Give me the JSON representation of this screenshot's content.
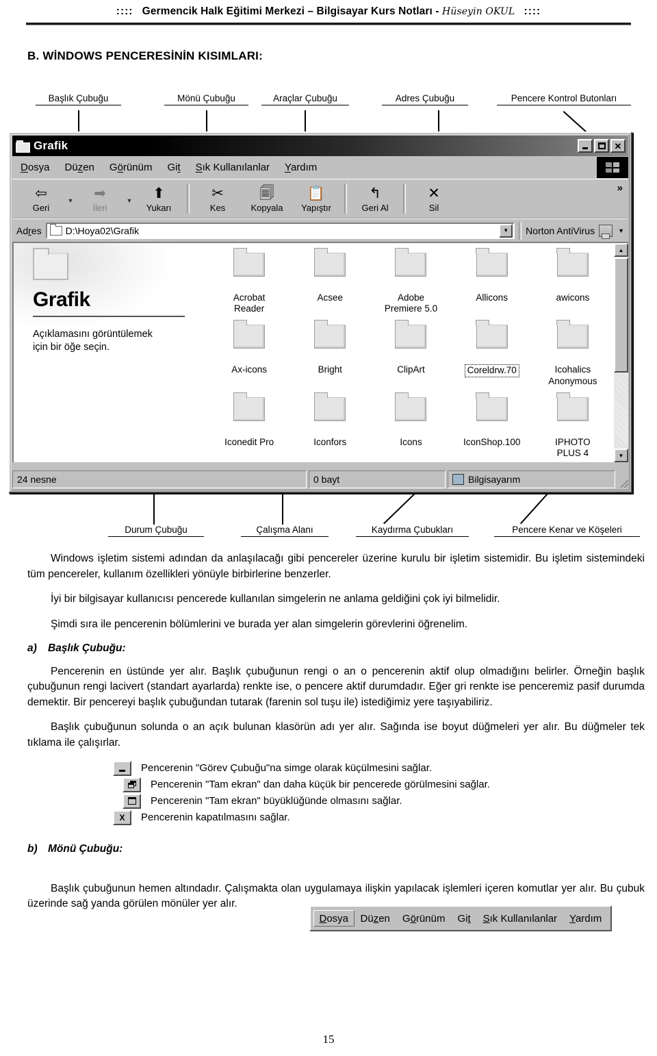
{
  "header": {
    "dots_left": "::::",
    "title": "Germencik Halk Eğitimi Merkezi – Bilgisayar Kurs Notları - ",
    "author": "Hüseyin OKUL",
    "dots_right": "::::"
  },
  "section_title": "B. WİNDOWS PENCERESİNİN KISIMLARI:",
  "diagram": {
    "callouts_top": [
      "Başlık Çubuğu",
      "Mönü Çubuğu",
      "Araçlar Çubuğu",
      "Adres Çubuğu",
      "Pencere Kontrol Butonları"
    ],
    "callouts_bottom": [
      "Durum Çubuğu",
      "Çalışma Alanı",
      "Kaydırma Çubukları",
      "Pencere Kenar ve Köşeleri"
    ],
    "window": {
      "title": "Grafik",
      "control_buttons": [
        "minimize",
        "maximize",
        "close"
      ],
      "menu_items": [
        {
          "pre": "",
          "hot": "D",
          "post": "osya"
        },
        {
          "pre": "Dü",
          "hot": "z",
          "post": "en"
        },
        {
          "pre": "G",
          "hot": "ö",
          "post": "rünüm"
        },
        {
          "pre": "Gi",
          "hot": "t",
          "post": ""
        },
        {
          "pre": "",
          "hot": "S",
          "post": "ık Kullanılanlar"
        },
        {
          "pre": "",
          "hot": "Y",
          "post": "ardım"
        }
      ],
      "toolbar": [
        {
          "label": "Geri",
          "icon": "back-arrow-icon",
          "glyph": "⇦",
          "disabled": false,
          "dropdown": true
        },
        {
          "label": "İleri",
          "icon": "forward-arrow-icon",
          "glyph": "➡",
          "disabled": true,
          "dropdown": true
        },
        {
          "label": "Yukarı",
          "icon": "up-folder-icon",
          "glyph": "⬆",
          "disabled": false,
          "dropdown": false
        },
        {
          "label": "Kes",
          "icon": "scissors-icon",
          "glyph": "✂",
          "disabled": false,
          "dropdown": false
        },
        {
          "label": "Kopyala",
          "icon": "copy-icon",
          "glyph": "🗐",
          "disabled": false,
          "dropdown": false
        },
        {
          "label": "Yapıştır",
          "icon": "paste-icon",
          "glyph": "📋",
          "disabled": false,
          "dropdown": false
        },
        {
          "label": "Geri Al",
          "icon": "undo-arrow-icon",
          "glyph": "↰",
          "disabled": false,
          "dropdown": false
        },
        {
          "label": "Sil",
          "icon": "delete-x-icon",
          "glyph": "✕",
          "disabled": false,
          "dropdown": false
        }
      ],
      "toolbar_overflow": "»",
      "address": {
        "label": "Adres",
        "value": "D:\\Hoya02\\Grafik",
        "antivirus_label": "Norton AntiVirus"
      },
      "left_pane": {
        "title": "Grafik",
        "description": "Açıklamasını görüntülemek için bir öğe seçin."
      },
      "folders": [
        {
          "name": "Acrobat\nReader",
          "focused": false
        },
        {
          "name": "Acsee",
          "focused": false
        },
        {
          "name": "Adobe\nPremiere 5.0",
          "focused": false
        },
        {
          "name": "Allicons",
          "focused": false
        },
        {
          "name": "awicons",
          "focused": false
        },
        {
          "name": "Ax-icons",
          "focused": false
        },
        {
          "name": "Bright",
          "focused": false
        },
        {
          "name": "ClipArt",
          "focused": false
        },
        {
          "name": "Coreldrw.70",
          "focused": true
        },
        {
          "name": "Icohalics\nAnonymous",
          "focused": false
        },
        {
          "name": "Iconedit Pro",
          "focused": false
        },
        {
          "name": "Iconfors",
          "focused": false
        },
        {
          "name": "Icons",
          "focused": false
        },
        {
          "name": "IconShop.100",
          "focused": false
        },
        {
          "name": "IPHOTO\nPLUS 4",
          "focused": false
        }
      ],
      "status_bar": {
        "objects": "24 nesne",
        "size": "0 bayt",
        "location": "Bilgisayarım"
      }
    }
  },
  "paragraphs": {
    "p1": "Windows işletim sistemi adından da anlaşılacağı gibi pencereler üzerine kurulu bir işletim sistemidir. Bu işletim sistemindeki tüm pencereler, kullanım özellikleri yönüyle birbirlerine benzerler.",
    "p2": "İyi bir bilgisayar kullanıcısı pencerede kullanılan simgelerin ne anlama geldiğini çok iyi bilmelidir.",
    "p3": "Şimdi sıra ile pencerenin bölümlerini ve burada yer alan simgelerin görevlerini öğrenelim.",
    "p4": "Pencerenin en üstünde yer alır. Başlık çubuğunun rengi o an o pencerenin aktif olup olmadığını belirler. Örneğin başlık çubuğunun rengi lacivert (standart ayarlarda) renkte ise, o pencere aktif durumdadır. Eğer gri renkte ise penceremiz pasif durumda demektir. Bir pencereyi başlık çubuğundan tutarak (farenin sol tuşu ile) istediğimiz yere taşıyabiliriz.",
    "p5": "Başlık çubuğunun solunda o an açık bulunan klasörün adı yer alır. Sağında ise  boyut düğmeleri yer alır. Bu düğmeler tek tıklama ile çalışırlar.",
    "p6": "Başlık çubuğunun hemen altındadır. Çalışmakta olan uygulamaya ilişkin yapılacak işlemleri içeren komutlar yer alır. Bu çubuk üzerinde sağ yanda görülen mönüler yer alır."
  },
  "subheads": {
    "a_marker": "a)",
    "a_label": "Başlık Çubuğu:",
    "b_marker": "b)",
    "b_label": "Mönü Çubuğu:"
  },
  "button_descriptions": [
    {
      "icon": "minimize-button-icon",
      "text": "Pencerenin \"Görev Çubuğu\"na simge olarak küçülmesini sağlar."
    },
    {
      "icon": "restore-button-icon",
      "text": "Pencerenin \"Tam ekran\" dan daha küçük bir pencerede görülmesini sağlar."
    },
    {
      "icon": "maximize-button-icon",
      "text": "Pencerenin \"Tam ekran\" büyüklüğünde olmasını sağlar."
    },
    {
      "icon": "close-button-icon",
      "text": "Pencerenin kapatılmasını sağlar."
    }
  ],
  "menu_sample": [
    {
      "pre": "",
      "hot": "D",
      "post": "osya",
      "active": true
    },
    {
      "pre": "Dü",
      "hot": "z",
      "post": "en",
      "active": false
    },
    {
      "pre": "G",
      "hot": "ö",
      "post": "rünüm",
      "active": false
    },
    {
      "pre": "Gi",
      "hot": "t",
      "post": "",
      "active": false
    },
    {
      "pre": "",
      "hot": "S",
      "post": "ık Kullanılanlar",
      "active": false
    },
    {
      "pre": "",
      "hot": "Y",
      "post": "ardım",
      "active": false
    }
  ],
  "page_number": "15"
}
